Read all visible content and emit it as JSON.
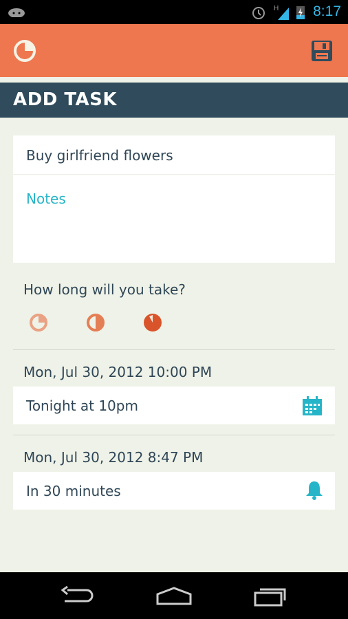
{
  "status_bar": {
    "time": "8:17",
    "icons": [
      "android-debug-icon",
      "alarm-icon",
      "signal-icon",
      "battery-charging-icon"
    ]
  },
  "action_bar": {
    "app_icon": "pie-clock-icon",
    "save_icon": "floppy-disk-icon"
  },
  "page_title": "ADD TASK",
  "task": {
    "title_value": "Buy girlfriend flowers",
    "notes_placeholder": "Notes"
  },
  "duration": {
    "question": "How long will you take?",
    "options": [
      {
        "icon": "quarter-pie-icon",
        "color": "#e9a283"
      },
      {
        "icon": "half-pie-icon",
        "color": "#e47f55"
      },
      {
        "icon": "full-pie-icon",
        "color": "#d9542a"
      }
    ]
  },
  "due": {
    "datetime": "Mon, Jul 30, 2012 10:00 PM",
    "value": "Tonight at 10pm",
    "icon": "calendar-icon"
  },
  "reminder": {
    "datetime": "Mon, Jul 30, 2012 8:47 PM",
    "value": "In 30 minutes",
    "icon": "bell-icon"
  },
  "colors": {
    "accent": "#ee774f",
    "header": "#2f4b5c",
    "teal": "#26b5c8",
    "background": "#eff2e8"
  },
  "nav_bar": {
    "icons": [
      "back-icon",
      "home-icon",
      "recents-icon"
    ]
  }
}
